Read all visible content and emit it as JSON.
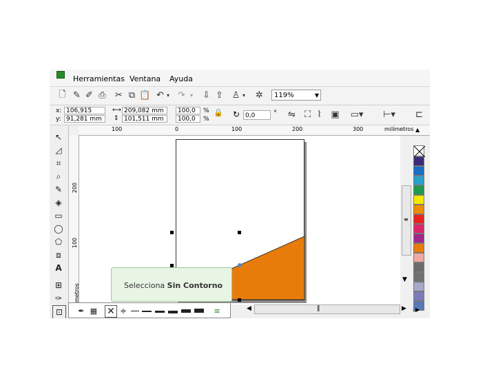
{
  "menu": {
    "herramientas": "Herramientas",
    "ventana": "Ventana",
    "ayuda": "Ayuda"
  },
  "toolbar": {
    "zoom_value": "119%"
  },
  "property_bar": {
    "x_label": "x:",
    "x_value": "106,915 mm",
    "y_label": "y:",
    "y_value": "91,281 mm",
    "width_value": "209,082 mm",
    "height_value": "101,511 mm",
    "scale_x": "100,0",
    "scale_y": "100,0",
    "percent_x": "%",
    "percent_y": "%",
    "rotation_value": "0,0",
    "degree": "°"
  },
  "ruler_h": {
    "labels": [
      "100",
      "0",
      "100",
      "200",
      "300"
    ],
    "unit": "milímetros"
  },
  "ruler_v": {
    "labels": [
      "200",
      "100"
    ],
    "unit": "ilímetros"
  },
  "tooltip": {
    "prefix": "Selecciona ",
    "bold": "Sin Contorno"
  },
  "palette": {
    "colors": [
      "#3c2a7a",
      "#1a6fc4",
      "#28a0c8",
      "#1e9a4a",
      "#f4e800",
      "#f08c00",
      "#e8241c",
      "#d8286a",
      "#a0288a",
      "#e87c0a",
      "#f0a8a0",
      "#6c6c6c",
      "#707070",
      "#a8a8c8",
      "#7c7cb8",
      "#5878b8"
    ]
  },
  "colors": {
    "accent_orange": "#e87c0a",
    "tooltip_bg": "#e8f4e4"
  },
  "icons": {
    "new": "new-document-icon",
    "open": "open-icon",
    "save": "save-icon",
    "cut": "cut-icon",
    "copy": "copy-icon",
    "paste": "paste-icon"
  }
}
